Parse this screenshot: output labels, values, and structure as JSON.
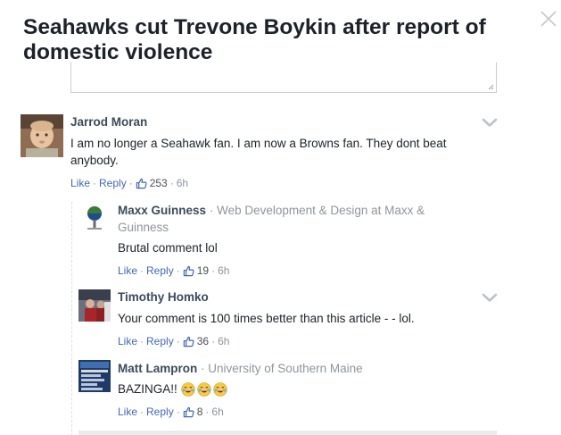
{
  "article": {
    "headline": "Seahawks cut Trevone Boykin after report of domestic violence"
  },
  "icons": {
    "close": "close-icon",
    "like": "thumbs-up-icon",
    "menu": "chevron-down-icon",
    "emoji": "laughing-emoji-icon"
  },
  "colors": {
    "link": "#4267b2",
    "meta": "#90949c",
    "author": "#3b4b5b"
  },
  "comments": [
    {
      "author": "Jarrod Moran",
      "text": "I am no longer a Seahawk fan. I am now a Browns fan. They dont beat anybody.",
      "like_label": "Like",
      "reply_label": "Reply",
      "likes": "253",
      "time": "6h",
      "replies": [
        {
          "author": "Maxx Guinness",
          "separator": "·",
          "affiliation": "Web Development & Design at Maxx &",
          "affiliation_cont": "Guinness",
          "text": "Brutal comment lol",
          "like_label": "Like",
          "reply_label": "Reply",
          "likes": "19",
          "time": "6h"
        },
        {
          "author": "Timothy Homko",
          "text": "Your comment is 100 times better than this article - - lol.",
          "like_label": "Like",
          "reply_label": "Reply",
          "likes": "36",
          "time": "6h"
        },
        {
          "author": "Matt Lampron",
          "separator": "·",
          "affiliation": "University of Southern Maine",
          "text": "BAZINGA!!",
          "emoji_count": 3,
          "like_label": "Like",
          "reply_label": "Reply",
          "likes": "8",
          "time": "6h"
        }
      ]
    }
  ]
}
